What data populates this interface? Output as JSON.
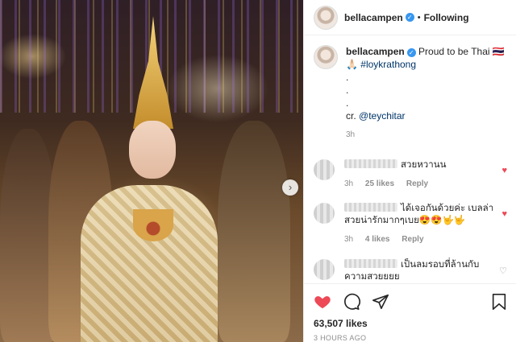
{
  "header": {
    "username": "bellacampen",
    "separator": "•",
    "follow_status": "Following"
  },
  "caption": {
    "username": "bellacampen",
    "text_line1": "Proud to be Thai 🇹🇭",
    "text_line2_prefix": "🙏🏻",
    "hashtag": "#loykrathong",
    "dots": [
      ".",
      ".",
      "."
    ],
    "credit_prefix": "cr.",
    "credit_mention": "@teychitar",
    "time": "3h"
  },
  "comments": [
    {
      "text": "สวยหวานน",
      "time": "3h",
      "likes": "25 likes",
      "reply": "Reply",
      "liked": true
    },
    {
      "text": "ได้เจอกันด้วยค่ะ เบลล่า สวยน่ารักมากๆเบย😍😍🤟🤟",
      "time": "3h",
      "likes": "4 likes",
      "reply": "Reply",
      "liked": true
    },
    {
      "text": "เป็นลมรอบที่ล้านกับ ความสวยยยย",
      "time": "",
      "likes": "",
      "reply": "",
      "liked": false
    }
  ],
  "actions": {
    "likes": "63,507 likes",
    "time": "3 HOURS AGO"
  },
  "colors": {
    "accent_blue": "#3897f0",
    "like_red": "#ed4956",
    "muted": "#8e8e8e"
  },
  "icons": [
    "verified-badge-icon",
    "heart-icon",
    "comment-icon",
    "share-icon",
    "bookmark-icon",
    "chevron-right-icon"
  ]
}
